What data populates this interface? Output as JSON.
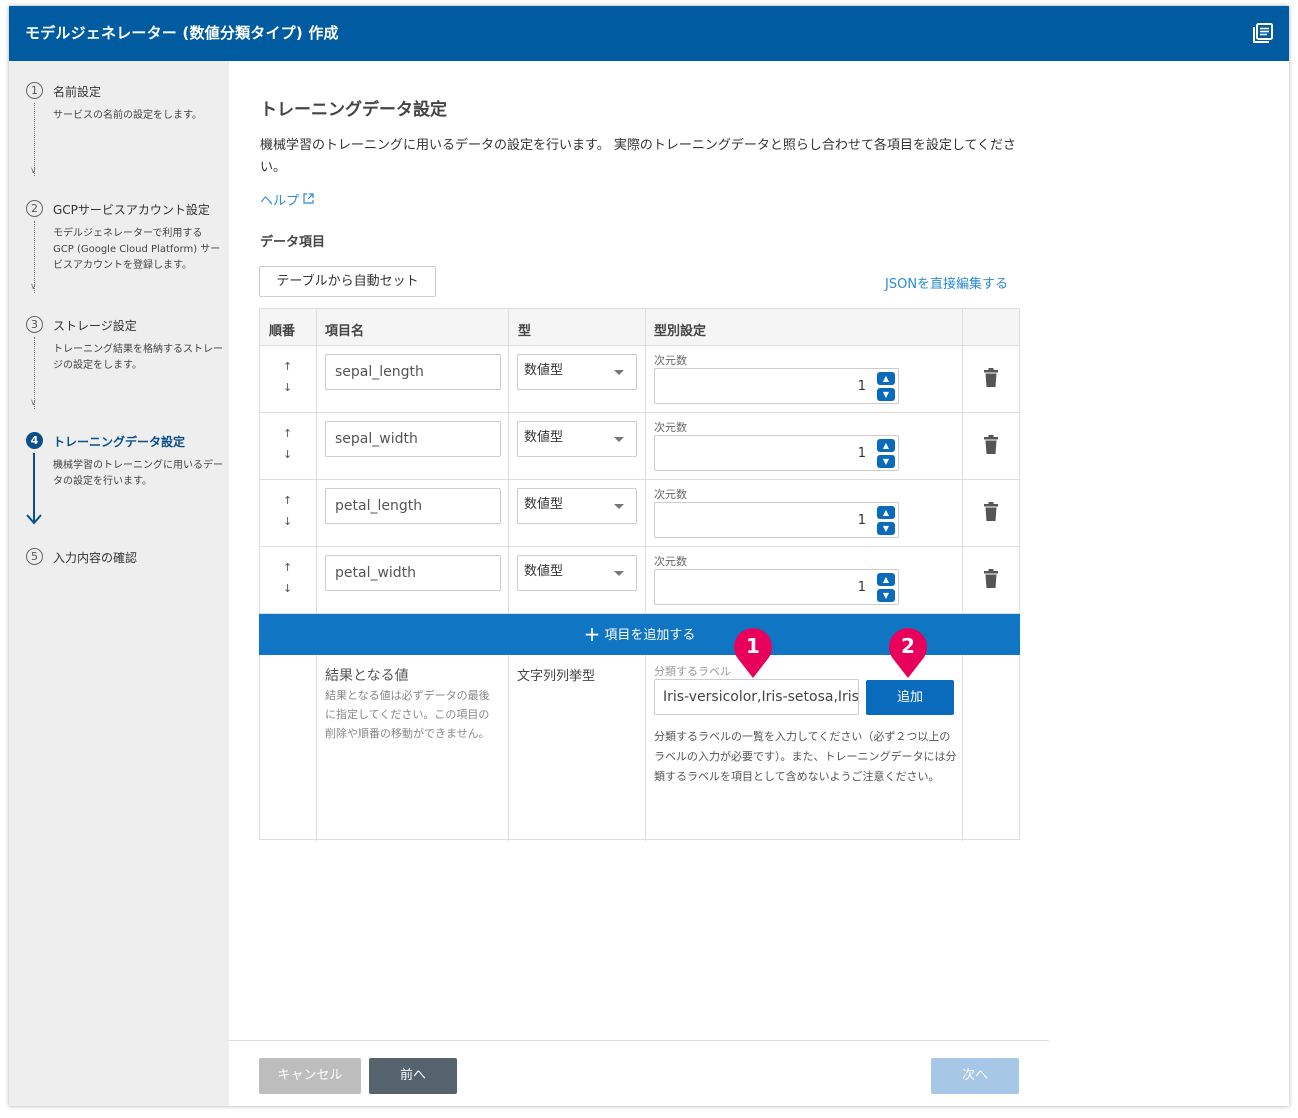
{
  "header": {
    "title": "モデルジェネレーター (数値分類タイプ) 作成",
    "icon": "book-icon"
  },
  "sidebar": {
    "steps": [
      {
        "num": "1",
        "label": "名前設定",
        "desc": "サービスの名前の設定をします。",
        "active": false
      },
      {
        "num": "2",
        "label": "GCPサービスアカウント設定",
        "desc": "モデルジェネレーターで利用する GCP (Google Cloud Platform) サービスアカウントを登録します。",
        "active": false
      },
      {
        "num": "3",
        "label": "ストレージ設定",
        "desc": "トレーニング結果を格納するストレージの設定をします。",
        "active": false
      },
      {
        "num": "4",
        "label": "トレーニングデータ設定",
        "desc": "機械学習のトレーニングに用いるデータの設定を行います。",
        "active": true
      },
      {
        "num": "5",
        "label": "入力内容の確認",
        "desc": "",
        "active": false
      }
    ]
  },
  "main": {
    "title": "トレーニングデータ設定",
    "intro": "機械学習のトレーニングに用いるデータの設定を行います。 実際のトレーニングデータと照らし合わせて各項目を設定してください。",
    "help_link": "ヘルプ",
    "section_title": "データ項目",
    "auto_set_button": "テーブルから自動セット",
    "json_link": "JSONを直接編集する"
  },
  "table": {
    "headers": {
      "order": "順番",
      "name": "項目名",
      "type": "型",
      "type_settings": "型別設定"
    },
    "rows": [
      {
        "name": "sepal_length",
        "type": "数値型",
        "dim_label": "次元数",
        "dim": "1"
      },
      {
        "name": "sepal_width",
        "type": "数値型",
        "dim_label": "次元数",
        "dim": "1"
      },
      {
        "name": "petal_length",
        "type": "数値型",
        "dim_label": "次元数",
        "dim": "1"
      },
      {
        "name": "petal_width",
        "type": "数値型",
        "dim_label": "次元数",
        "dim": "1"
      }
    ],
    "add_item": "項目を追加する",
    "result": {
      "title": "結果となる値",
      "desc": "結果となる値は必ずデータの最後に指定してください。この項目の削除や順番の移動ができません。",
      "type": "文字列列挙型",
      "label_caption": "分類するラベル",
      "label_value": "Iris-versicolor,Iris-setosa,Iris-virginica",
      "add_button": "追加",
      "help": "分類するラベルの一覧を入力してください（必ず２つ以上のラベルの入力が必要です）。また、トレーニングデータには分類するラベルを項目として含めないようご注意ください。"
    }
  },
  "callouts": {
    "first": "1",
    "second": "2",
    "color": "#e8005a"
  },
  "footer": {
    "cancel": "キャンセル",
    "prev": "前へ",
    "next": "次へ"
  },
  "colors": {
    "header": "#005ba1",
    "accent": "#1075c2",
    "link": "#2a8ad4"
  }
}
